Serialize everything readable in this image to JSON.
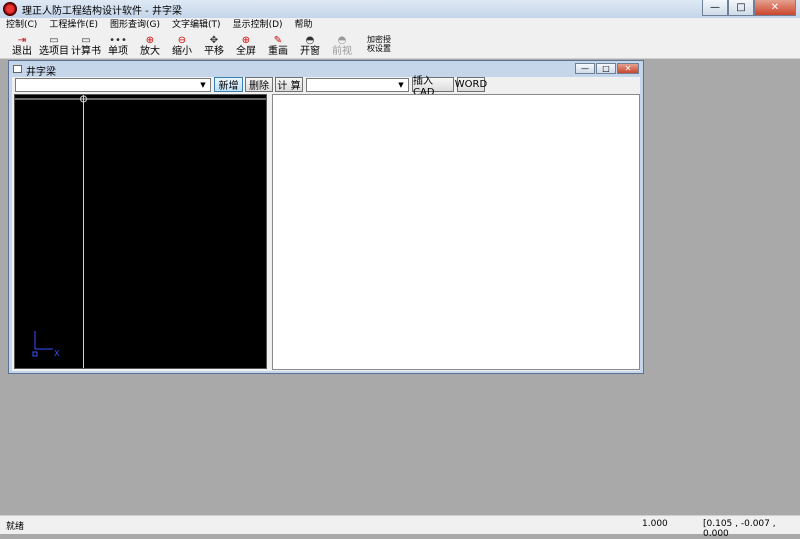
{
  "app": {
    "title": "理正人防工程结构设计软件 - 井字梁"
  },
  "window_controls": {
    "minimize": "—",
    "maximize": "□",
    "close": "✕"
  },
  "menu": [
    "控制(C)",
    "工程操作(E)",
    "图形查询(G)",
    "文字编辑(T)",
    "显示控制(D)",
    "帮助"
  ],
  "toolbar": [
    {
      "label": "退出",
      "icon": "exit-icon",
      "glyph": "⇥"
    },
    {
      "label": "选项目",
      "icon": "folder-icon",
      "glyph": "▭"
    },
    {
      "label": "计算书",
      "icon": "calc-book-icon",
      "glyph": "▭"
    },
    {
      "label": "单项",
      "icon": "item-icon",
      "glyph": "•••"
    },
    {
      "label": "放大",
      "icon": "zoom-in-icon",
      "glyph": "⊕"
    },
    {
      "label": "缩小",
      "icon": "zoom-out-icon",
      "glyph": "⊖"
    },
    {
      "label": "平移",
      "icon": "pan-icon",
      "glyph": "✥"
    },
    {
      "label": "全屏",
      "icon": "fullscreen-icon",
      "glyph": "⊕"
    },
    {
      "label": "重画",
      "icon": "redraw-icon",
      "glyph": "✎"
    },
    {
      "label": "开窗",
      "icon": "window-icon",
      "glyph": "◓"
    },
    {
      "label": "前视",
      "icon": "front-view-icon",
      "glyph": "◓",
      "disabled": true
    }
  ],
  "toolbar_extra": {
    "line1": "加密授",
    "line2": "权设置"
  },
  "child": {
    "title": "井字梁",
    "buttons": {
      "new": "新增",
      "delete": "删除",
      "calc": "计 算",
      "insert_cad": "插入CAD",
      "word": "WORD"
    },
    "combo1_value": "",
    "combo2_value": "",
    "combo_arrow": "▼"
  },
  "status": {
    "text": "就绪",
    "scale": "1.000",
    "coords": "[0.105 , -0.007 , 0.000"
  },
  "colors": {
    "canvas_bg": "#000000",
    "axis_blue": "#3355ff",
    "desktop": "#a9a9a9"
  },
  "axis": {
    "x_label": "X"
  }
}
